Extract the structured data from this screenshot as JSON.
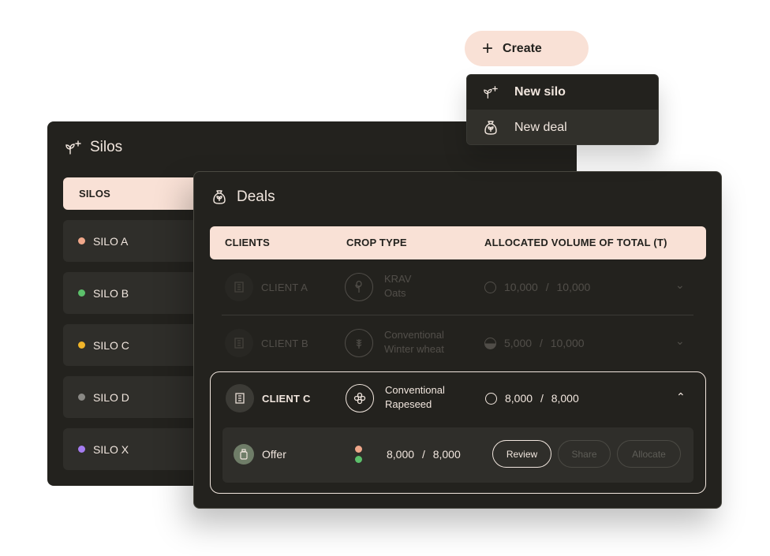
{
  "create": {
    "label": "Create"
  },
  "menu": {
    "items": [
      {
        "label": "New silo",
        "icon": "sprout-plus-icon"
      },
      {
        "label": "New deal",
        "icon": "money-bag-icon"
      }
    ]
  },
  "silos": {
    "title": "Silos",
    "tab_label": "SILOS",
    "items": [
      {
        "label": "SILO A",
        "color": "#f0a78a"
      },
      {
        "label": "SILO B",
        "color": "#5cc06b"
      },
      {
        "label": "SILO C",
        "color": "#f0b429"
      },
      {
        "label": "SILO D",
        "color": "#8a8985"
      },
      {
        "label": "SILO X",
        "color": "#a57cf0"
      }
    ]
  },
  "deals": {
    "title": "Deals",
    "columns": {
      "clients": "CLIENTS",
      "crop_type": "CROP TYPE",
      "volume": "ALLOCATED VOLUME OF TOTAL (T)"
    },
    "rows": [
      {
        "client": "CLIENT A",
        "crop_line1": "KRAV",
        "crop_line2": "Oats",
        "allocated": "10,000",
        "sep": "/",
        "total": "10,000"
      },
      {
        "client": "CLIENT B",
        "crop_line1": "Conventional",
        "crop_line2": "Winter wheat",
        "allocated": "5,000",
        "sep": "/",
        "total": "10,000"
      },
      {
        "client": "CLIENT C",
        "crop_line1": "Conventional",
        "crop_line2": "Rapeseed",
        "allocated": "8,000",
        "sep": "/",
        "total": "8,000"
      }
    ],
    "offer": {
      "label": "Offer",
      "allocated": "8,000",
      "sep": "/",
      "total": "8,000",
      "dot_colors": [
        "#f0a78a",
        "#5cc06b"
      ],
      "review_label": "Review",
      "share_label": "Share",
      "allocate_label": "Allocate"
    }
  },
  "colors": {
    "panel": "#23221e",
    "accent": "#f9e1d6",
    "row": "#2f2e2a"
  }
}
